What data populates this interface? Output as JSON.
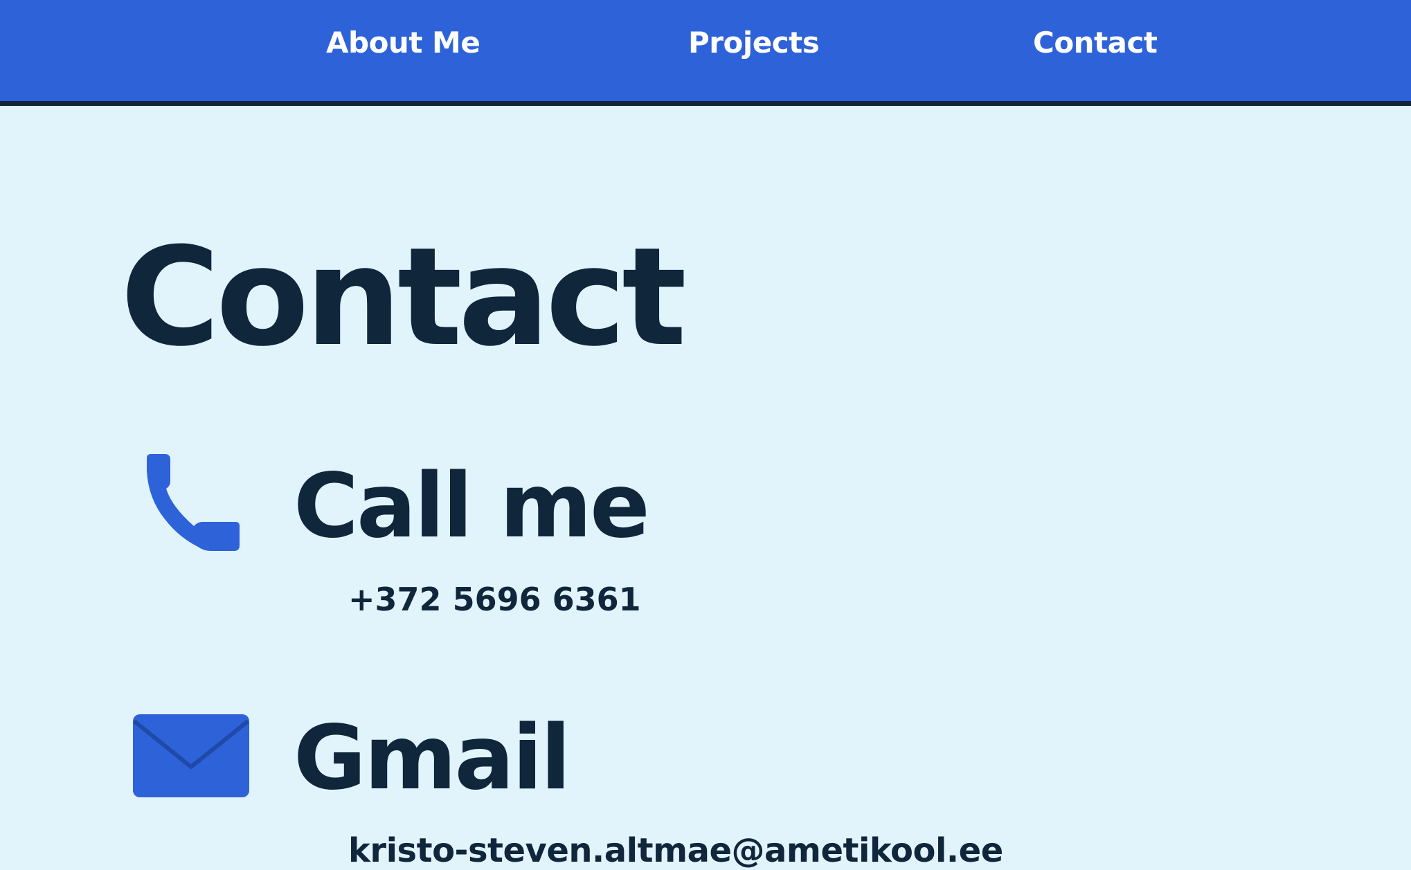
{
  "nav": {
    "items": [
      {
        "label": "About Me"
      },
      {
        "label": "Projects"
      },
      {
        "label": "Contact"
      }
    ]
  },
  "main": {
    "title": "Contact",
    "call": {
      "icon": "phone-icon",
      "heading": "Call me",
      "value": "+372 5696 6361"
    },
    "gmail": {
      "icon": "mail-icon",
      "heading": "Gmail",
      "value": "kristo-steven.altmae@ametikool.ee"
    }
  },
  "colors": {
    "navbar": "#2e62d9",
    "navbar_border": "#10263b",
    "background": "#e1f4fc",
    "text": "#10263b",
    "icon": "#2e62d9"
  }
}
